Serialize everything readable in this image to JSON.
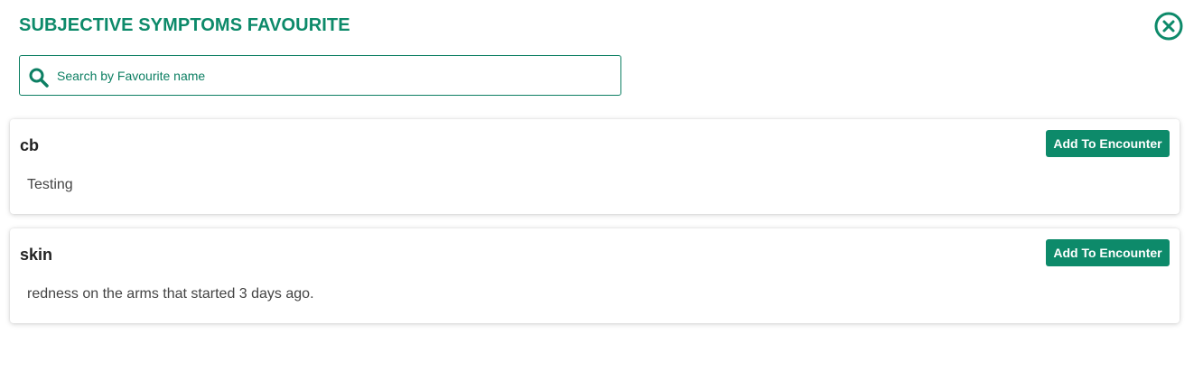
{
  "header": {
    "title": "SUBJECTIVE SYMPTOMS FAVOURITE",
    "close_icon": "close-circle-icon"
  },
  "search": {
    "placeholder": "Search by Favourite name",
    "value": "",
    "icon": "search-icon"
  },
  "favourites": [
    {
      "name": "cb",
      "description": "Testing",
      "button_label": "Add To Encounter"
    },
    {
      "name": "skin",
      "description": "redness on the arms that started 3 days ago.",
      "button_label": "Add To Encounter"
    }
  ],
  "colors": {
    "accent": "#0d8a6a",
    "border": "#0d7f63",
    "text_dark": "#222222",
    "text_body": "#444444"
  }
}
